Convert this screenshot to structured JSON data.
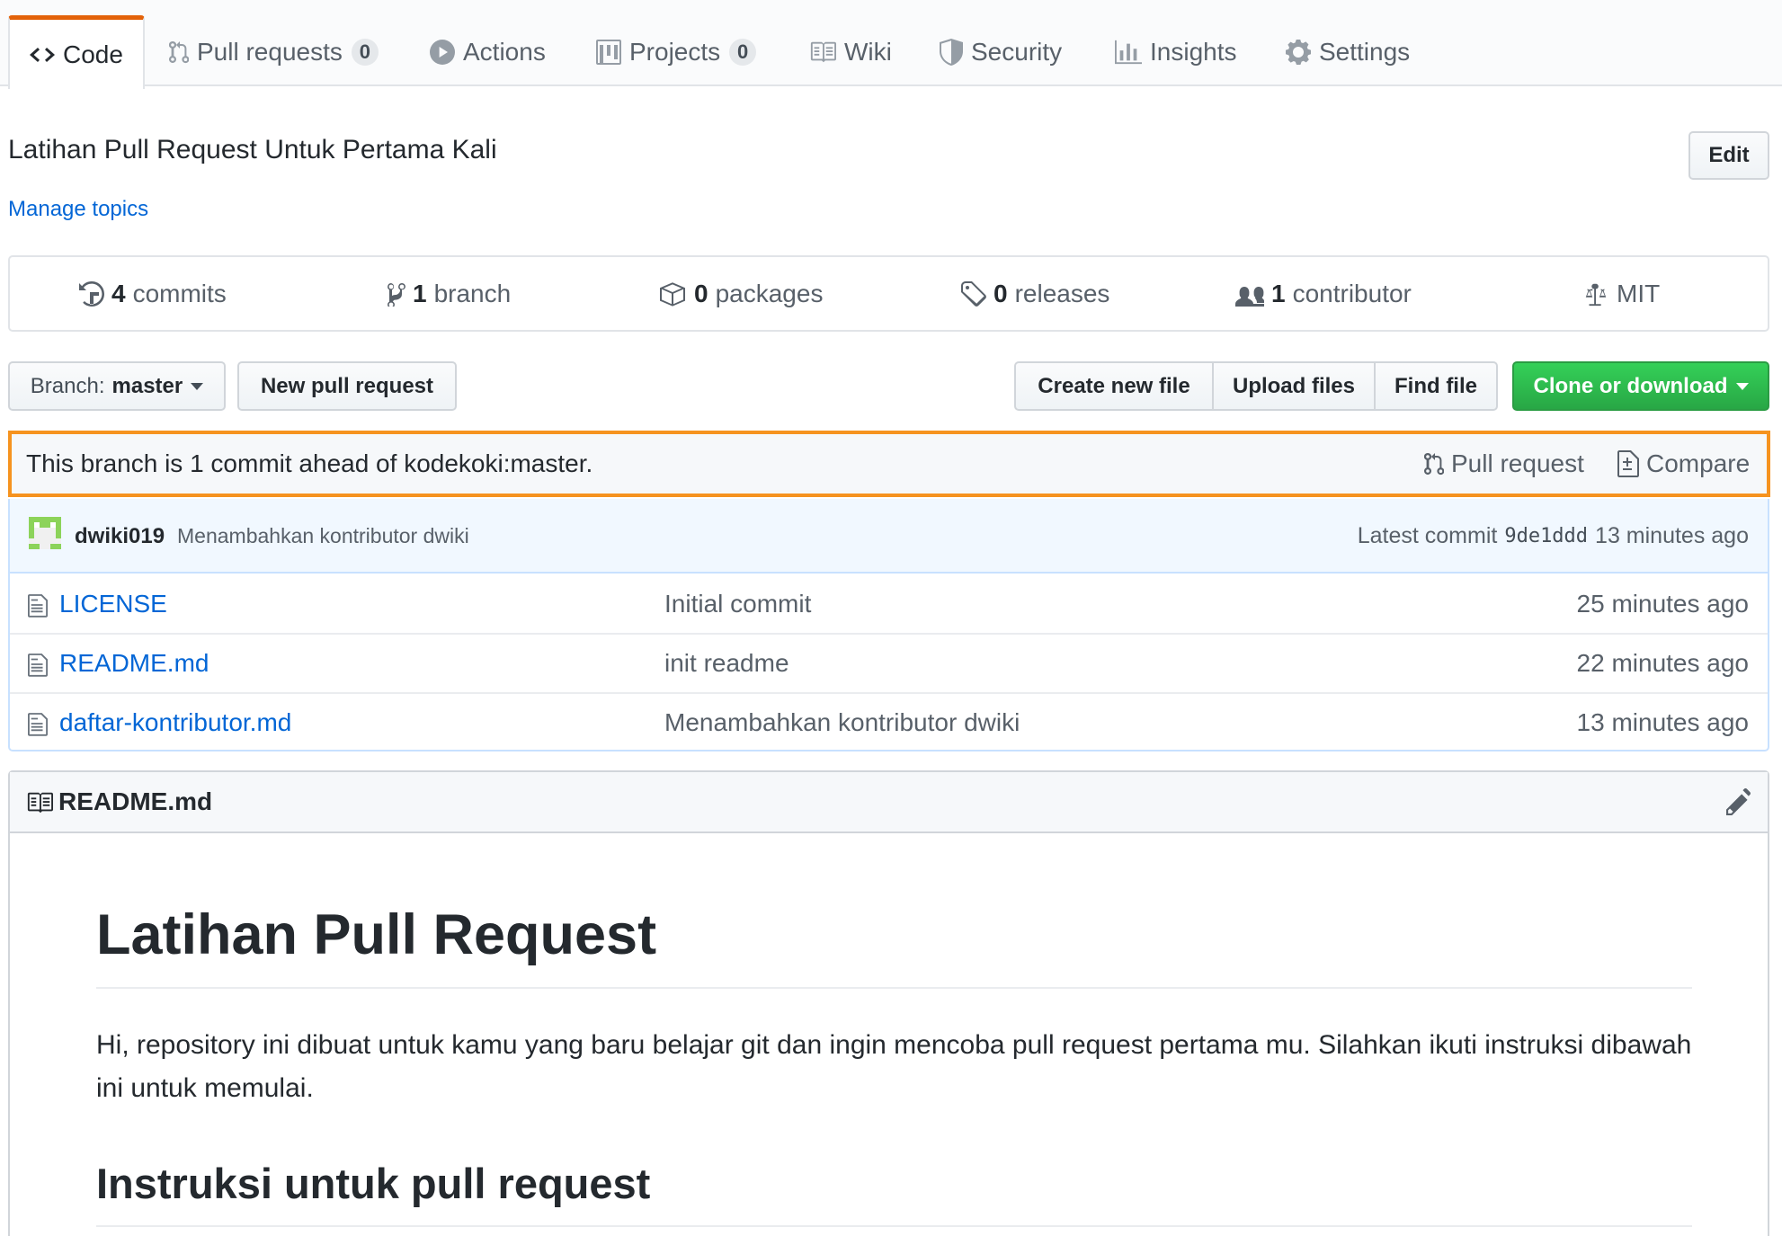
{
  "tabs": [
    {
      "label": "Code",
      "icon": "code-icon"
    },
    {
      "label": "Pull requests",
      "count": "0",
      "icon": "git-pull-request-icon"
    },
    {
      "label": "Actions",
      "icon": "play-icon"
    },
    {
      "label": "Projects",
      "count": "0",
      "icon": "project-icon"
    },
    {
      "label": "Wiki",
      "icon": "book-icon"
    },
    {
      "label": "Security",
      "icon": "shield-icon"
    },
    {
      "label": "Insights",
      "icon": "graph-icon"
    },
    {
      "label": "Settings",
      "icon": "gear-icon"
    }
  ],
  "repo": {
    "description": "Latihan Pull Request Untuk Pertama Kali",
    "manage_topics": "Manage topics",
    "edit_label": "Edit"
  },
  "summary": {
    "commits": {
      "count": "4",
      "label": "commits"
    },
    "branches": {
      "count": "1",
      "label": "branch"
    },
    "packages": {
      "count": "0",
      "label": "packages"
    },
    "releases": {
      "count": "0",
      "label": "releases"
    },
    "contributors": {
      "count": "1",
      "label": "contributor"
    },
    "license": "MIT"
  },
  "file_nav": {
    "branch_prefix": "Branch:",
    "branch_name": "master",
    "new_pr": "New pull request",
    "create_file": "Create new file",
    "upload_files": "Upload files",
    "find_file": "Find file",
    "clone": "Clone or download"
  },
  "ahead_banner": {
    "text": "This branch is 1 commit ahead of kodekoki:master.",
    "pull_request": "Pull request",
    "compare": "Compare",
    "highlight_color": "#f6931f"
  },
  "latest_commit": {
    "author": "dwiki019",
    "message": "Menambahkan kontributor dwiki",
    "prefix": "Latest commit",
    "sha": "9de1ddd",
    "age": "13 minutes ago"
  },
  "files": [
    {
      "name": "LICENSE",
      "message": "Initial commit",
      "age": "25 minutes ago"
    },
    {
      "name": "README.md",
      "message": "init readme",
      "age": "22 minutes ago"
    },
    {
      "name": "daftar-kontributor.md",
      "message": "Menambahkan kontributor dwiki",
      "age": "13 minutes ago"
    }
  ],
  "readme": {
    "filename": "README.md",
    "h1": "Latihan Pull Request",
    "paragraph": "Hi, repository ini dibuat untuk kamu yang baru belajar git dan ingin mencoba pull request pertama mu. Silahkan ikuti instruksi dibawah ini untuk memulai.",
    "h2": "Instruksi untuk pull request"
  },
  "colors": {
    "link": "#0366d6",
    "tab_accent": "#e36209",
    "clone_button": "#28a745"
  }
}
